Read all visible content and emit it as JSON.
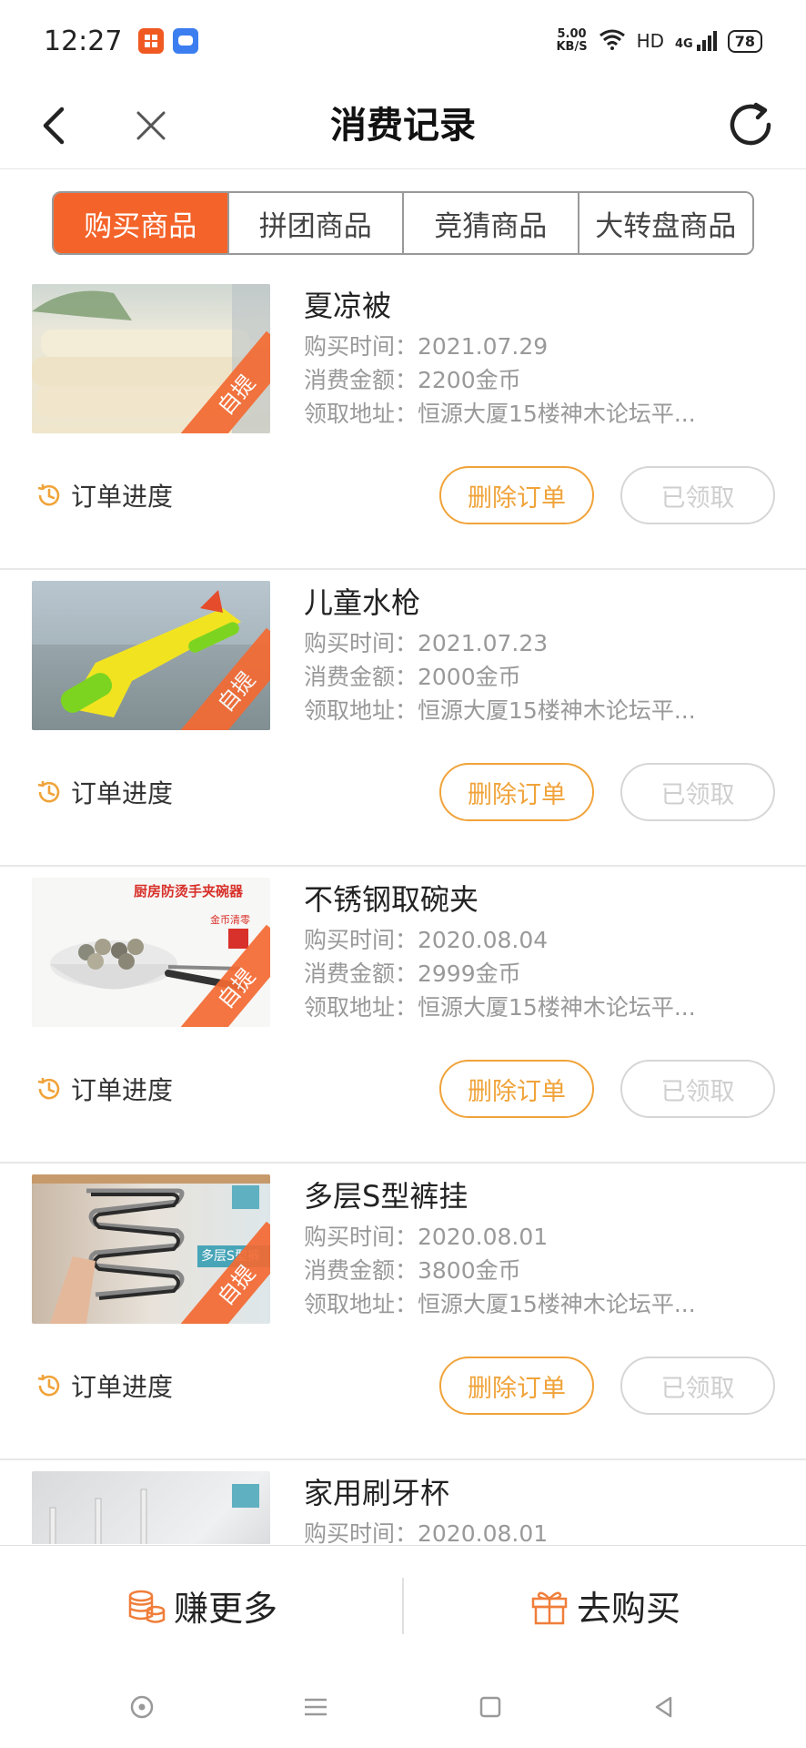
{
  "status_bar": {
    "time": "12:27",
    "net_speed_value": "5.00",
    "net_speed_unit": "KB/S",
    "hd": "HD",
    "signal": "4G",
    "battery": "78"
  },
  "header": {
    "title": "消费记录"
  },
  "tabs": [
    {
      "label": "购买商品",
      "active": true
    },
    {
      "label": "拼团商品",
      "active": false
    },
    {
      "label": "竞猜商品",
      "active": false
    },
    {
      "label": "大转盘商品",
      "active": false
    }
  ],
  "ribbon_label": "自提",
  "items": [
    {
      "name": "夏凉被",
      "purchase_time": "购买时间：2021.07.29",
      "amount": "消费金额：2200金币",
      "address": "领取地址：恒源大厦15楼神木论坛平...",
      "progress_label": "订单进度",
      "delete_label": "删除订单",
      "status_label": "已领取"
    },
    {
      "name": "儿童水枪",
      "purchase_time": "购买时间：2021.07.23",
      "amount": "消费金额：2000金币",
      "address": "领取地址：恒源大厦15楼神木论坛平...",
      "progress_label": "订单进度",
      "delete_label": "删除订单",
      "status_label": "已领取"
    },
    {
      "name": "不锈钢取碗夹",
      "purchase_time": "购买时间：2020.08.04",
      "amount": "消费金额：2999金币",
      "address": "领取地址：恒源大厦15楼神木论坛平...",
      "progress_label": "订单进度",
      "delete_label": "删除订单",
      "status_label": "已领取",
      "image_text": "厨房防烫手夹碗器",
      "image_subtext": "金币清零"
    },
    {
      "name": "多层S型裤挂",
      "purchase_time": "购买时间：2020.08.01",
      "amount": "消费金额：3800金币",
      "address": "领取地址：恒源大厦15楼神木论坛平...",
      "progress_label": "订单进度",
      "delete_label": "删除订单",
      "status_label": "已领取",
      "image_text": "多层S型裤"
    },
    {
      "name": "家用刷牙杯",
      "purchase_time": "购买时间：2020.08.01"
    }
  ],
  "actions": {
    "earn_more": "赚更多",
    "go_buy": "去购买"
  },
  "colors": {
    "accent": "#f4632a",
    "button_orange": "#f0a33a",
    "muted_text": "#999999"
  }
}
